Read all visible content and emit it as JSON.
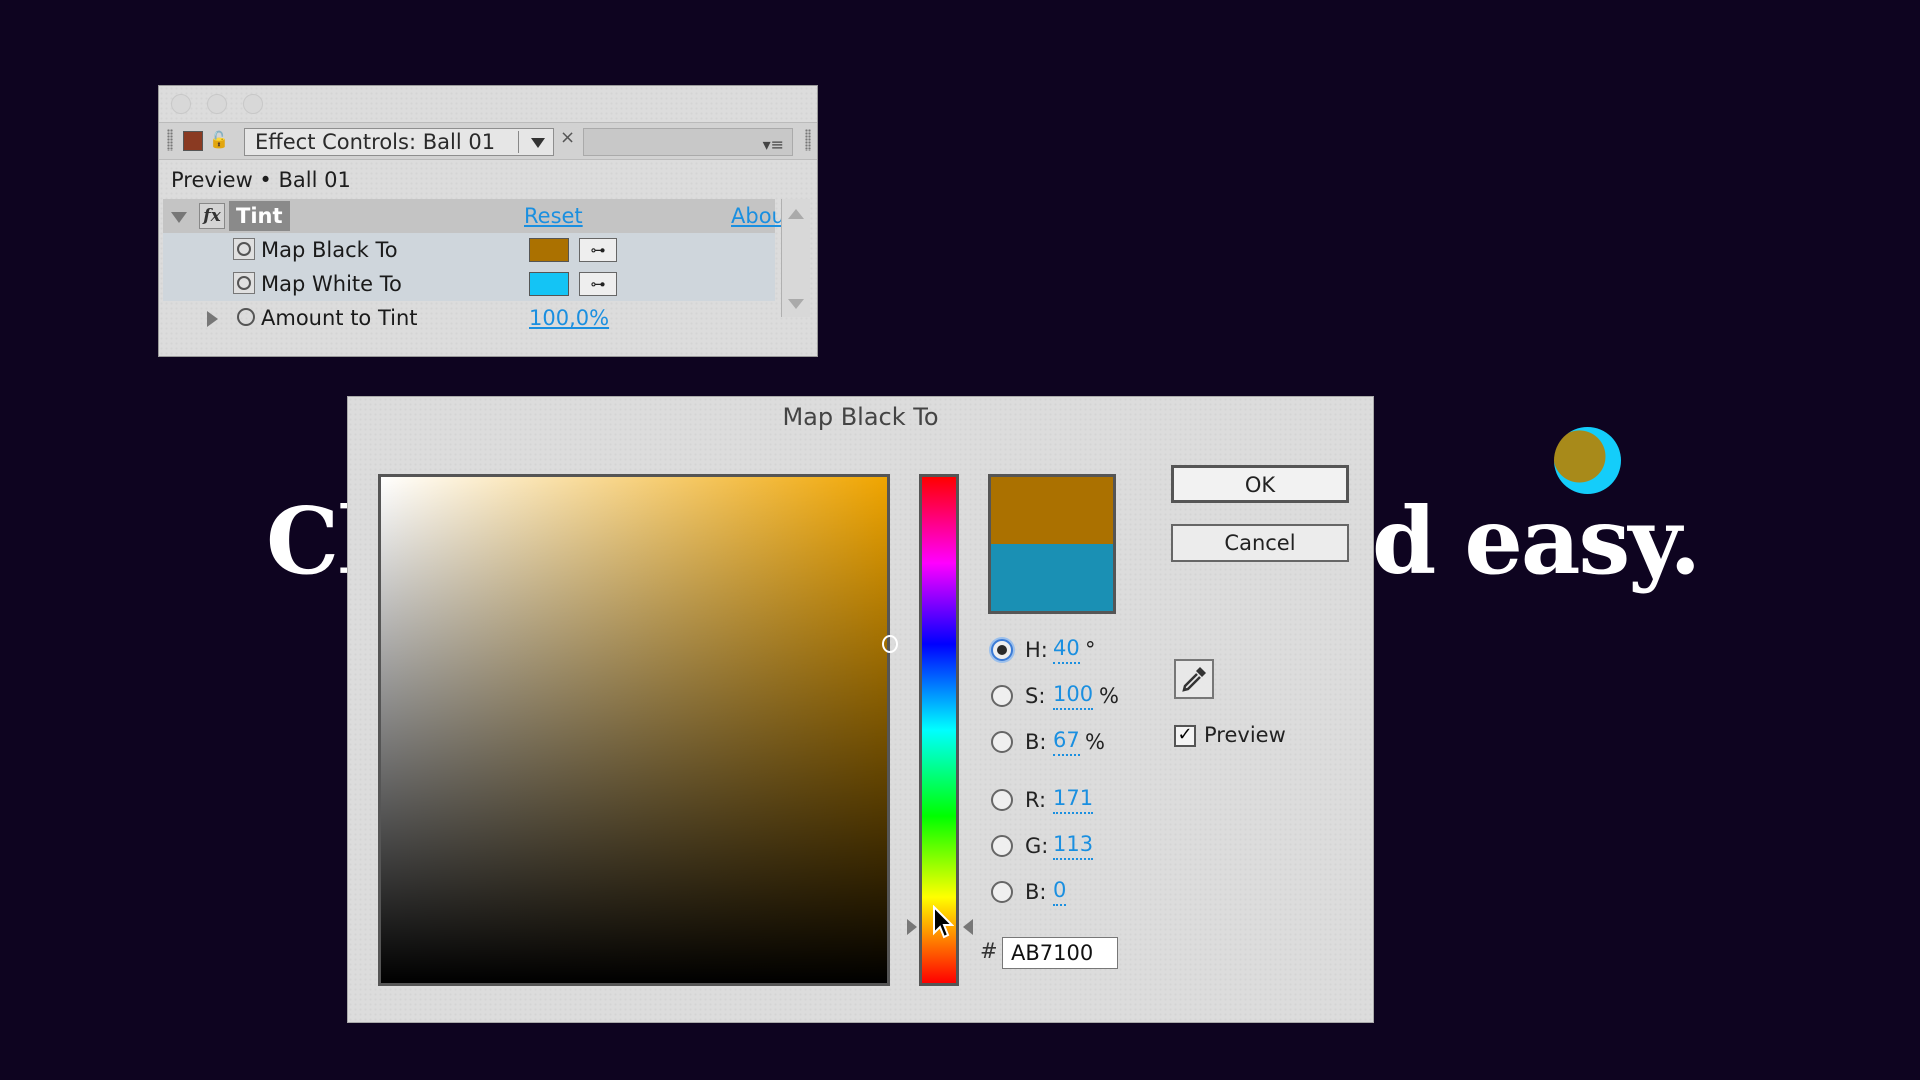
{
  "background": {
    "headline_left": "Cl",
    "headline_right": "d easy.",
    "ball_colors": [
      "#AB7100",
      "#14CDFA"
    ]
  },
  "effect_panel": {
    "tab_label": "Effect Controls: Ball 01",
    "breadcrumb": "Preview • Ball 01",
    "effect": {
      "fx_icon": "fx",
      "name": "Tint",
      "reset": "Reset",
      "about": "Abou"
    },
    "properties": [
      {
        "label": "Map Black To",
        "color": "#AB7100"
      },
      {
        "label": "Map White To",
        "color": "#14C4F5"
      },
      {
        "label": "Amount to Tint",
        "value": "100,0%"
      }
    ]
  },
  "color_picker": {
    "title": "Map Black To",
    "new_color": "#AB7100",
    "old_color": "#1A90B4",
    "fields": {
      "h": {
        "label": "H:",
        "value": "40",
        "unit": "°",
        "selected": true
      },
      "s": {
        "label": "S:",
        "value": "100",
        "unit": "%"
      },
      "b": {
        "label": "B:",
        "value": "67",
        "unit": "%"
      },
      "r": {
        "label": "R:",
        "value": "171"
      },
      "g": {
        "label": "G:",
        "value": "113"
      },
      "bl": {
        "label": "B:",
        "value": "0"
      }
    },
    "hash": "#",
    "hex": "AB7100",
    "ok_label": "OK",
    "cancel_label": "Cancel",
    "preview_label": "Preview",
    "preview_checked": true
  }
}
